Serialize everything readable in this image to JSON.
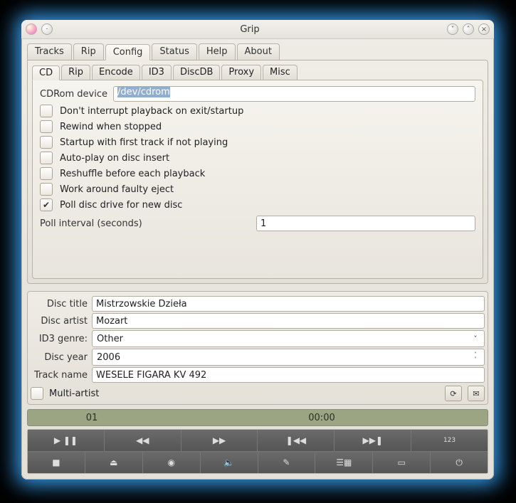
{
  "window": {
    "title": "Grip"
  },
  "main_tabs": [
    "Tracks",
    "Rip",
    "Config",
    "Status",
    "Help",
    "About"
  ],
  "active_main_tab": "Config",
  "config_tabs": [
    "CD",
    "Rip",
    "Encode",
    "ID3",
    "DiscDB",
    "Proxy",
    "Misc"
  ],
  "active_config_tab": "CD",
  "cd_config": {
    "device_label": "CDRom device",
    "device_value": "/dev/cdrom",
    "checks": [
      {
        "label": "Don't interrupt playback on exit/startup",
        "checked": false
      },
      {
        "label": "Rewind when stopped",
        "checked": false
      },
      {
        "label": "Startup with first track if not playing",
        "checked": false
      },
      {
        "label": "Auto-play on disc insert",
        "checked": false
      },
      {
        "label": "Reshuffle before each playback",
        "checked": false
      },
      {
        "label": "Work around faulty eject",
        "checked": false
      },
      {
        "label": "Poll disc drive for new disc",
        "checked": true
      }
    ],
    "poll_label": "Poll interval (seconds)",
    "poll_value": "1"
  },
  "disc": {
    "title_label": "Disc title",
    "title_value": "Mistrzowskie Dzieła",
    "artist_label": "Disc artist",
    "artist_value": "Mozart",
    "genre_label": "ID3 genre:",
    "genre_value": "Other",
    "year_label": "Disc year",
    "year_value": "2006",
    "track_label": "Track name",
    "track_value": "WESELE FIGARA KV 492",
    "multi_artist_label": "Multi-artist"
  },
  "status": {
    "track": "01",
    "time": "00:00"
  },
  "controls_row1": [
    "play-pause",
    "rewind",
    "fast-forward",
    "prev-track",
    "next-track",
    "toggle-display"
  ],
  "controls_row2": [
    "stop",
    "eject",
    "record",
    "volume",
    "edit",
    "playlist",
    "window-toggle",
    "power"
  ]
}
